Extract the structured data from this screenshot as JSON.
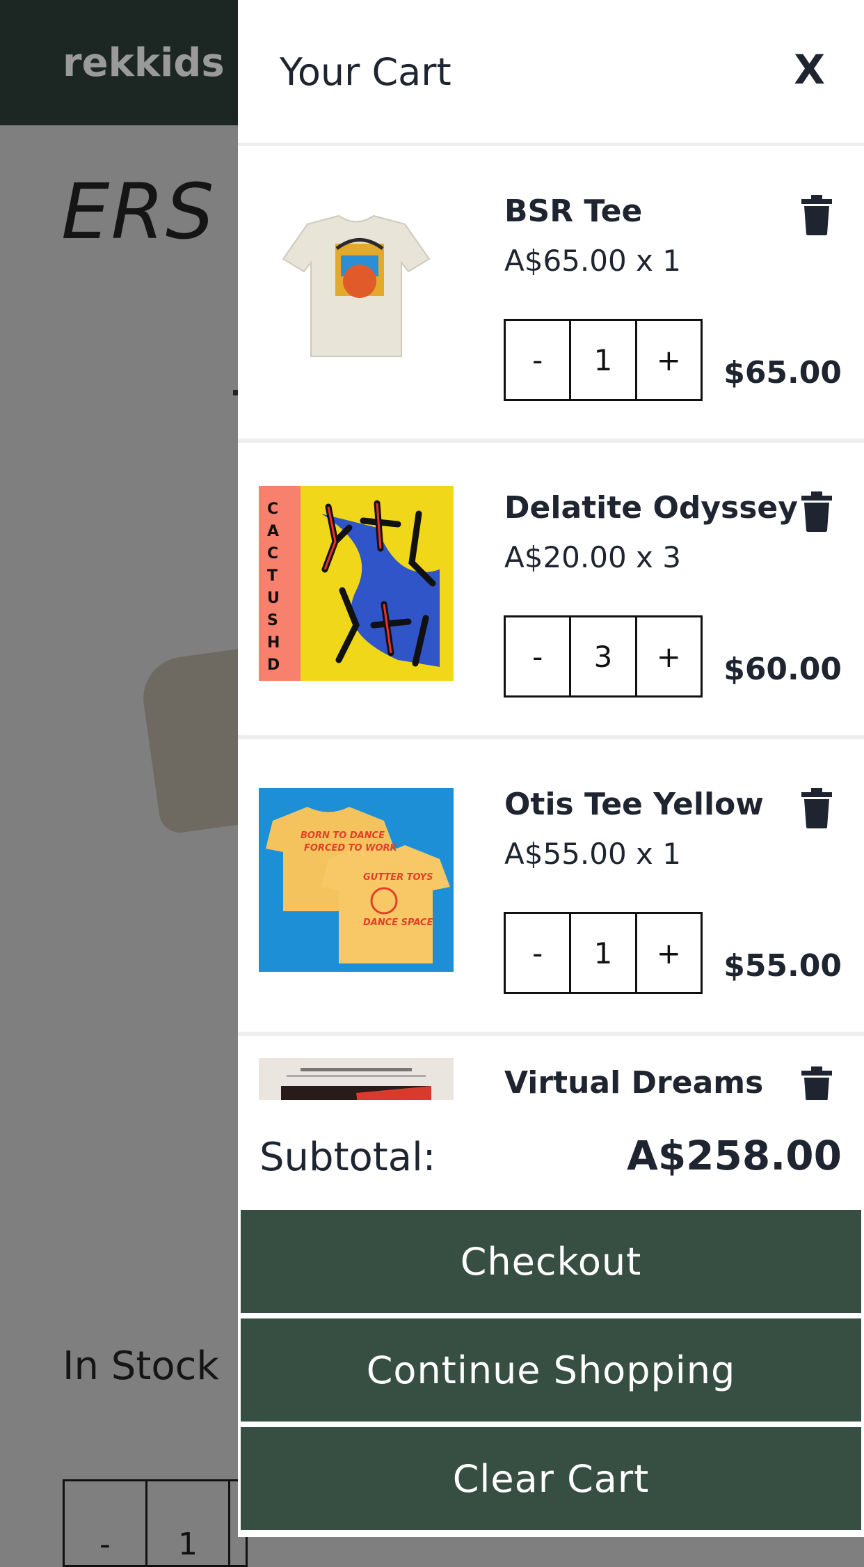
{
  "background": {
    "logo": "rekkids r",
    "title_fragment": "ERS C",
    "stock_text": "In Stock",
    "stepper": {
      "minus": "-",
      "value": "1"
    }
  },
  "cart": {
    "title": "Your Cart",
    "close_label": "X",
    "items": [
      {
        "name": "BSR Tee",
        "unit_price": "A$65.00 x 1",
        "minus": "-",
        "qty": "1",
        "plus": "+",
        "line_total": "$65.00",
        "image": "cream-tshirt"
      },
      {
        "name": "Delatite Odyssey",
        "unit_price": "A$20.00 x 3",
        "minus": "-",
        "qty": "3",
        "plus": "+",
        "line_total": "$60.00",
        "image": "cactushead-cassette"
      },
      {
        "name": "Otis Tee Yellow",
        "unit_price": "A$55.00 x 1",
        "minus": "-",
        "qty": "1",
        "plus": "+",
        "line_total": "$55.00",
        "image": "yellow-tshirts"
      },
      {
        "name": "Virtual Dreams",
        "image": "virtual-dreams-cover"
      }
    ],
    "subtotal_label": "Subtotal:",
    "subtotal_value": "A$258.00",
    "buttons": {
      "checkout": "Checkout",
      "continue": "Continue Shopping",
      "clear": "Clear Cart"
    },
    "colors": {
      "button_bg": "#374f43",
      "header_bg": "#1c2622",
      "text": "#1f2530"
    }
  }
}
